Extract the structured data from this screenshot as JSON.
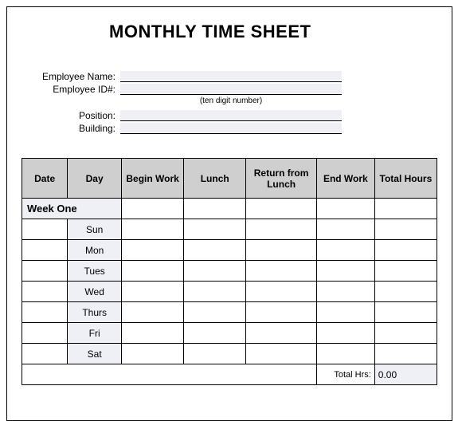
{
  "title": "MONTHLY TIME SHEET",
  "info": {
    "name_label": "Employee Name:",
    "name_value": "",
    "id_label": "Employee ID#:",
    "id_value": "",
    "id_helper": "(ten digit number)",
    "position_label": "Position:",
    "position_value": "",
    "building_label": "Building:",
    "building_value": ""
  },
  "headers": {
    "date": "Date",
    "day": "Day",
    "begin": "Begin Work",
    "lunch": "Lunch",
    "return": "Return from Lunch",
    "end": "End Work",
    "total": "Total Hours"
  },
  "week_label": "Week One",
  "days": [
    "Sun",
    "Mon",
    "Tues",
    "Wed",
    "Thurs",
    "Fri",
    "Sat"
  ],
  "footer": {
    "total_label": "Total Hrs:",
    "total_value": "0.00"
  }
}
